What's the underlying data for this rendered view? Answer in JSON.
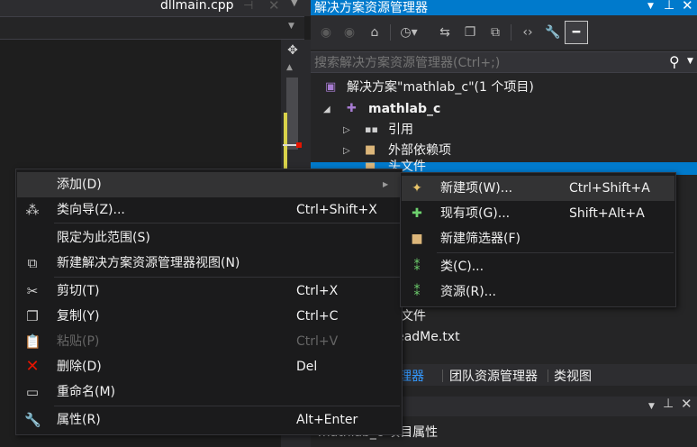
{
  "colors": {
    "accent": "#007acc",
    "background": "#1e1e1e",
    "menu_bg": "#1b1b1c",
    "delete_red": "#e51400"
  },
  "editor": {
    "tab_label": "dllmain.cpp",
    "tab_pin_icon": "pin-icon",
    "tab_close_icon": "close-icon"
  },
  "solution_explorer": {
    "title": "解决方案资源管理器",
    "search_placeholder": "搜索解决方案资源管理器(Ctrl+;)",
    "toolbar_icons": [
      "back-icon",
      "forward-icon",
      "home-icon",
      "pending-changes-icon",
      "sync-icon",
      "collapse-all-icon",
      "show-all-files-icon",
      "view-code-icon",
      "properties-icon",
      "preview-icon"
    ],
    "tree": [
      {
        "label": "解决方案\"mathlab_c\"(1 个项目)",
        "icon": "solution-icon"
      },
      {
        "label": "mathlab_c",
        "icon": "project-icon"
      },
      {
        "label": "引用",
        "icon": "references-icon"
      },
      {
        "label": "外部依赖项",
        "icon": "external-deps-icon"
      },
      {
        "label": "头文件",
        "icon": "folder-icon"
      },
      {
        "label": "源文件",
        "icon": "folder-icon"
      },
      {
        "label": "ReadMe.txt",
        "icon": "file-icon"
      }
    ],
    "bottom_tabs": [
      "解决方案资源管理器",
      "团队资源管理器",
      "类视图"
    ],
    "properties_label": "mathlab_c 项目属性"
  },
  "context_menu": {
    "items": [
      {
        "label": "添加(D)",
        "shortcut": "",
        "icon": "",
        "has_submenu": true
      },
      {
        "label": "类向导(Z)...",
        "shortcut": "Ctrl+Shift+X",
        "icon": "class-wizard-icon"
      },
      {
        "label": "限定为此范围(S)",
        "shortcut": "",
        "icon": ""
      },
      {
        "label": "新建解决方案资源管理器视图(N)",
        "shortcut": "",
        "icon": "new-view-icon"
      },
      {
        "label": "剪切(T)",
        "shortcut": "Ctrl+X",
        "icon": "cut-icon"
      },
      {
        "label": "复制(Y)",
        "shortcut": "Ctrl+C",
        "icon": "copy-icon"
      },
      {
        "label": "粘贴(P)",
        "shortcut": "Ctrl+V",
        "icon": "paste-icon",
        "disabled": true
      },
      {
        "label": "删除(D)",
        "shortcut": "Del",
        "icon": "delete-icon"
      },
      {
        "label": "重命名(M)",
        "shortcut": "",
        "icon": "rename-icon"
      },
      {
        "label": "属性(R)",
        "shortcut": "Alt+Enter",
        "icon": "wrench-icon"
      }
    ]
  },
  "submenu": {
    "items": [
      {
        "label": "新建项(W)...",
        "shortcut": "Ctrl+Shift+A",
        "icon": "new-item-icon"
      },
      {
        "label": "现有项(G)...",
        "shortcut": "Shift+Alt+A",
        "icon": "existing-item-icon"
      },
      {
        "label": "新建筛选器(F)",
        "shortcut": "",
        "icon": "new-filter-icon"
      },
      {
        "label": "类(C)...",
        "shortcut": "",
        "icon": "class-icon"
      },
      {
        "label": "资源(R)...",
        "shortcut": "",
        "icon": "resource-icon"
      }
    ]
  }
}
